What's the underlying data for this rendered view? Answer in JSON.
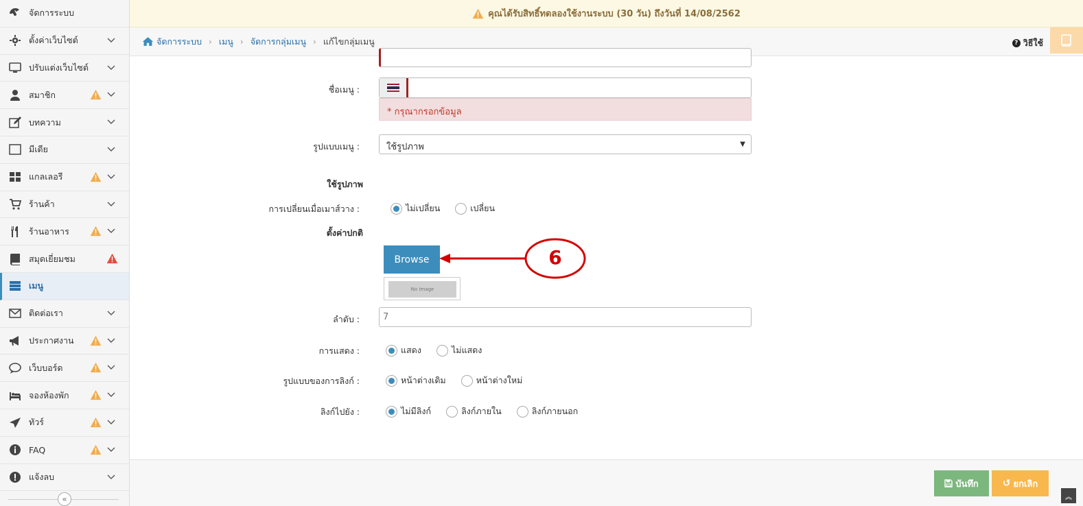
{
  "sidebar": {
    "items": [
      {
        "label": "จัดการระบบ",
        "icon": "dashboard-icon",
        "warn": false,
        "chev": false
      },
      {
        "label": "ตั้งค่าเว็บไซต์",
        "icon": "gear-icon",
        "warn": false,
        "chev": true
      },
      {
        "label": "ปรับแต่งเว็บไซต์",
        "icon": "monitor-icon",
        "warn": false,
        "chev": true
      },
      {
        "label": "สมาชิก",
        "icon": "user-icon",
        "warn": true,
        "chev": true
      },
      {
        "label": "บทความ",
        "icon": "edit-icon",
        "warn": false,
        "chev": true
      },
      {
        "label": "มีเดีย",
        "icon": "film-icon",
        "warn": false,
        "chev": true
      },
      {
        "label": "แกลเลอรี",
        "icon": "grid-icon",
        "warn": true,
        "chev": true
      },
      {
        "label": "ร้านค้า",
        "icon": "cart-icon",
        "warn": false,
        "chev": true
      },
      {
        "label": "ร้านอาหาร",
        "icon": "cutlery-icon",
        "warn": true,
        "chev": true
      },
      {
        "label": "สมุดเยี่ยมชม",
        "icon": "book-icon",
        "warn": "red",
        "chev": false
      },
      {
        "label": "เมนู",
        "icon": "menu-icon",
        "warn": false,
        "chev": false,
        "active": true
      },
      {
        "label": "ติดต่อเรา",
        "icon": "envelope-icon",
        "warn": false,
        "chev": true
      },
      {
        "label": "ประกาศงาน",
        "icon": "megaphone-icon",
        "warn": true,
        "chev": true
      },
      {
        "label": "เว็บบอร์ด",
        "icon": "chat-icon",
        "warn": true,
        "chev": true
      },
      {
        "label": "จองห้องพัก",
        "icon": "bed-icon",
        "warn": true,
        "chev": true
      },
      {
        "label": "ทัวร์",
        "icon": "plane-icon",
        "warn": true,
        "chev": true
      },
      {
        "label": "FAQ",
        "icon": "info-icon",
        "warn": true,
        "chev": true
      },
      {
        "label": "แจ้งลบ",
        "icon": "alert-icon",
        "warn": false,
        "chev": true
      }
    ],
    "collapse_glyph": "«"
  },
  "notice": {
    "text": "คุณได้รับสิทธิ์ทดลองใช้งานระบบ (30 วัน) ถึงวันที่ 14/08/2562"
  },
  "breadcrumb": {
    "items": [
      "จัดการระบบ",
      "เมนู",
      "จัดการกลุ่มเมนู",
      "แก้ไขกลุ่มเมนู"
    ],
    "help": "วิธีใช้"
  },
  "form": {
    "menu_name_label": "ชื่อเมนู :",
    "menu_name_value": "",
    "error_text": "* กรุณากรอกข้อมูล",
    "menu_type_label": "รูปแบบเมนู :",
    "menu_type_value": "ใช้รูปภาพ",
    "section_image": "ใช้รูปภาพ",
    "hover_label": "การเปลี่ยนเมื่อเมาส์วาง :",
    "hover_options": [
      "ไม่เปลี่ยน",
      "เปลี่ยน"
    ],
    "section_default": "ตั้งค่าปกติ",
    "browse_label": "Browse",
    "noimage_text": "No Image",
    "order_label": "ลำดับ :",
    "order_value": "7",
    "display_label": "การแสดง :",
    "display_options": [
      "แสดง",
      "ไม่แสดง"
    ],
    "link_style_label": "รูปแบบของการลิงก์ :",
    "link_style_options": [
      "หน้าต่างเดิม",
      "หน้าต่างใหม่"
    ],
    "link_to_label": "ลิงก์ไปยัง :",
    "link_to_options": [
      "ไม่มีลิงก์",
      "ลิงก์ภายใน",
      "ลิงก์ภายนอก"
    ]
  },
  "annotation": {
    "number": "6"
  },
  "footer": {
    "save_label": "บันทึก",
    "cancel_label": "ยกเลิก"
  },
  "colors": {
    "primary": "#3c8dbc",
    "save": "#7cb77e",
    "cancel": "#f8b84e",
    "error": "#a32020",
    "annotation": "#d40000"
  }
}
